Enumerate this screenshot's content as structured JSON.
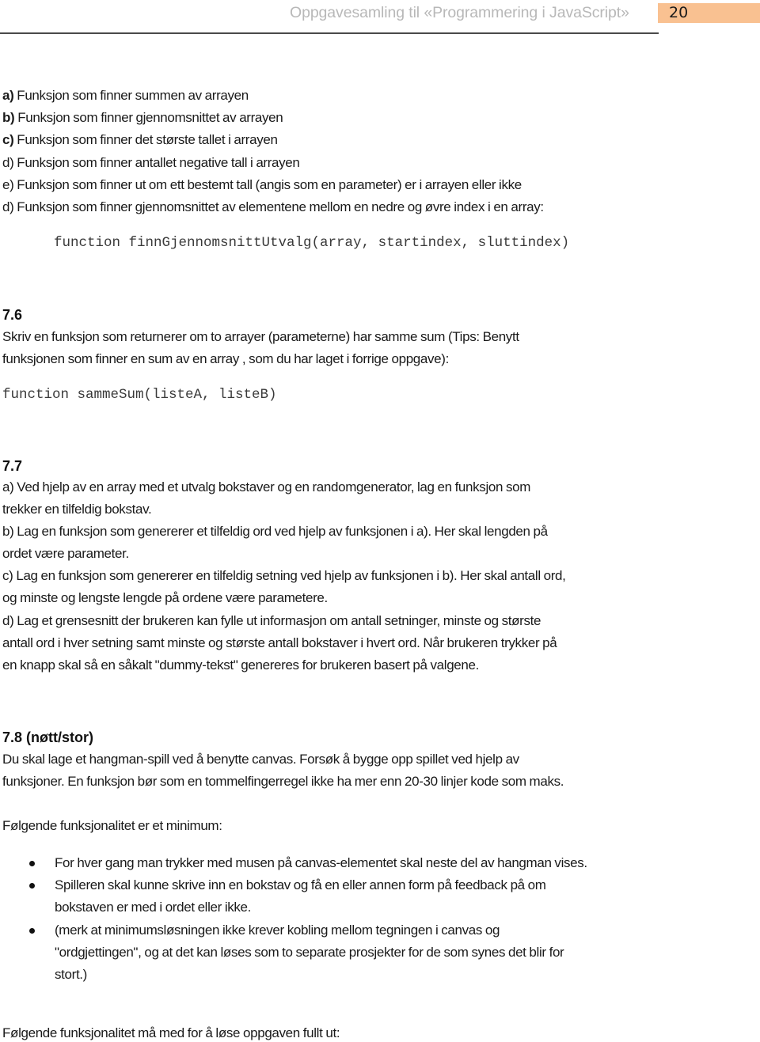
{
  "header": {
    "title": "Oppgavesamling til «Programmering i JavaScript»",
    "page_number": "20",
    "badge_color": "#f9c191"
  },
  "section_7_5_list": [
    {
      "label": "a)",
      "label_bold": true,
      "text": " Funksjon som finner summen av arrayen"
    },
    {
      "label": "b)",
      "label_bold": true,
      "text": " Funksjon som finner gjennomsnittet av arrayen"
    },
    {
      "label": "c)",
      "label_bold": true,
      "text": " Funksjon som finner det største tallet i arrayen"
    },
    {
      "label": "d)",
      "label_bold": false,
      "text": " Funksjon som finner antallet negative tall i arrayen"
    },
    {
      "label": "e)",
      "label_bold": false,
      "text": " Funksjon som finner ut om ett bestemt tall (angis som en parameter) er i arrayen eller ikke"
    },
    {
      "label": "d)",
      "label_bold": false,
      "text": " Funksjon som finner gjennomsnittet av elementene mellom en nedre og øvre index i en array:"
    }
  ],
  "section_7_5_code": "function finnGjennomsnittUtvalg(array, startindex, sluttindex)",
  "section_7_6": {
    "heading": "7.6",
    "lines": [
      "Skriv en funksjon som returnerer om to arrayer (parameterne) har samme sum (Tips: Benytt",
      "funksjonen som finner en sum av en array , som du har laget i forrige oppgave):"
    ],
    "code": "function sammeSum(listeA, listeB)"
  },
  "section_7_7": {
    "heading": "7.7",
    "lines": [
      "a) Ved hjelp av en array med et utvalg bokstaver og en randomgenerator, lag en funksjon som",
      "trekker en tilfeldig bokstav.",
      "b) Lag en funksjon som genererer et tilfeldig ord ved hjelp av funksjonen i a). Her skal lengden på",
      "ordet være parameter.",
      "c) Lag en funksjon som genererer en tilfeldig setning ved hjelp av funksjonen i b). Her skal antall ord,",
      "og minste og lengste lengde på ordene være parametere.",
      "d) Lag et grensesnitt der brukeren kan fylle ut informasjon om antall setninger, minste og største",
      "antall ord i hver setning samt minste og største antall bokstaver i hvert ord. Når brukeren trykker på",
      "en knapp skal så en såkalt \"dummy-tekst\" genereres for brukeren basert på valgene."
    ]
  },
  "section_7_8": {
    "heading": "7.8 (nøtt/stor)",
    "lines": [
      "Du skal lage et hangman-spill ved å benytte canvas. Forsøk å bygge opp spillet ved hjelp av",
      "funksjoner. En funksjon bør som en tommelfingerregel ikke ha mer enn 20-30 linjer kode som maks."
    ],
    "minimum_intro": "Følgende funksjonalitet er et minimum:",
    "bullets": [
      {
        "lines": [
          "For hver gang man trykker med musen på canvas-elementet skal neste del av hangman vises."
        ]
      },
      {
        "lines": [
          "Spilleren skal kunne skrive inn en bokstav og få en eller annen form på feedback på om",
          "bokstaven er med i ordet eller ikke."
        ]
      },
      {
        "lines": [
          "(merk at minimumsløsningen ikke krever kobling mellom tegningen i canvas og",
          "\"ordgjettingen\", og at det kan løses som to separate prosjekter for de som synes det blir for",
          "stort.)"
        ]
      }
    ],
    "full_intro": "Følgende funksjonalitet må med for å løse oppgaven fullt ut:"
  }
}
